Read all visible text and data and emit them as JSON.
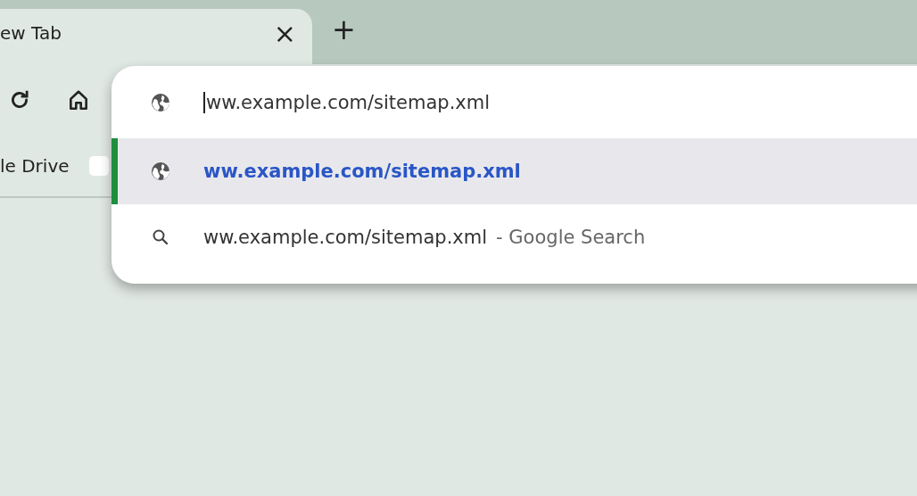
{
  "tab": {
    "title": "ew Tab",
    "close": "×"
  },
  "new_tab": "+",
  "bookmarks": [
    {
      "label": "le Drive"
    }
  ],
  "omnibox": {
    "value": "ww.example.com/sitemap.xml"
  },
  "suggestions": [
    {
      "kind": "url",
      "text": "ww.example.com/sitemap.xml",
      "selected": true
    },
    {
      "kind": "search",
      "text": "ww.example.com/sitemap.xml",
      "suffix": "- Google Search",
      "selected": false
    }
  ]
}
